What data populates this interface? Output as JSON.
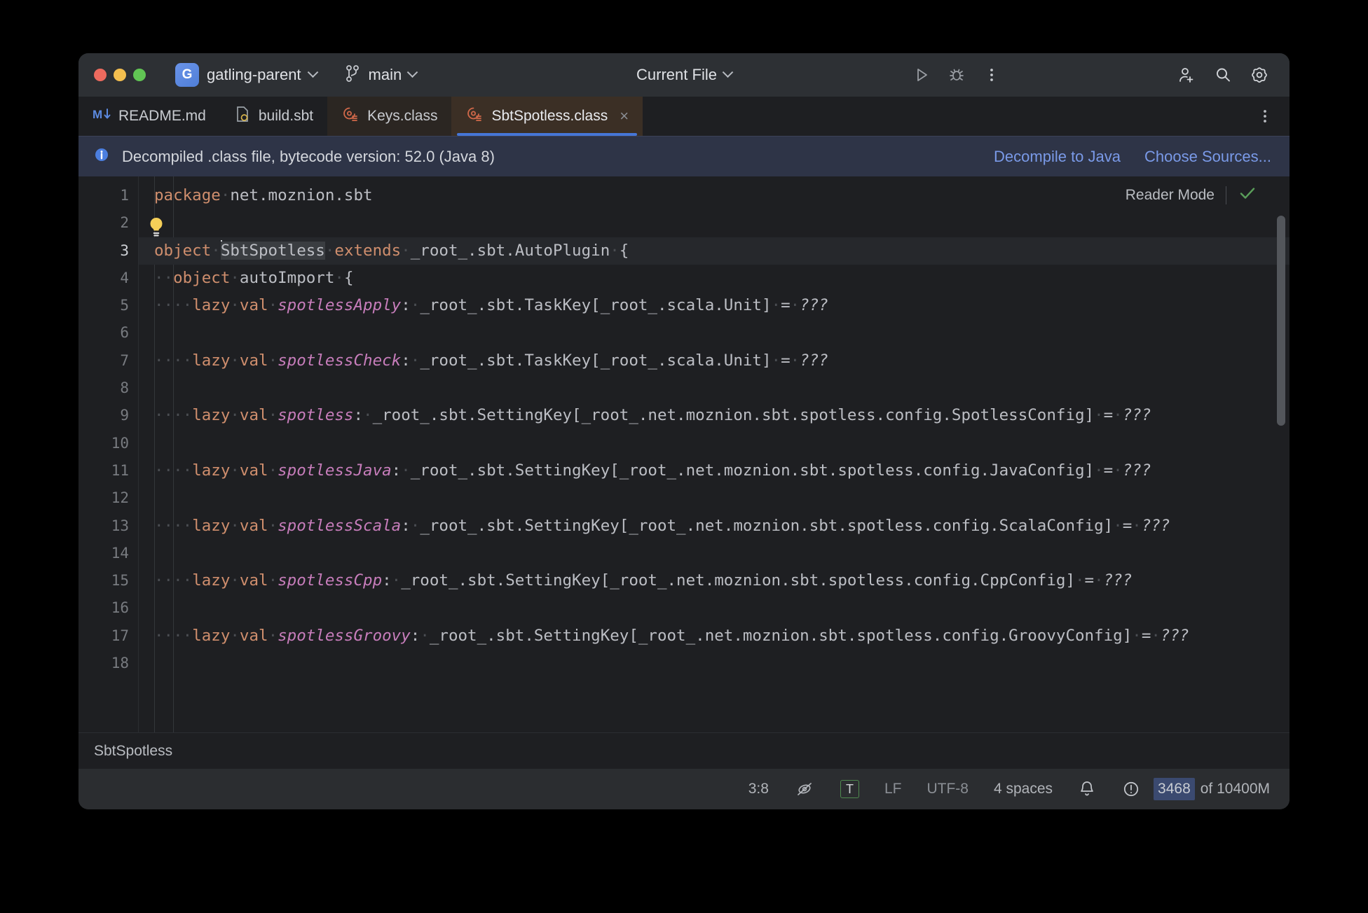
{
  "window": {
    "traffic_lights": [
      "close",
      "minimize",
      "zoom"
    ],
    "project": {
      "badge": "G",
      "name": "gatling-parent"
    },
    "branch": {
      "name": "main",
      "icon": "git-branch-icon"
    },
    "run_config": {
      "label": "Current File"
    },
    "toolbar_icons": [
      "run-icon",
      "debug-icon",
      "more-vertical-icon",
      "add-user-icon",
      "search-icon",
      "settings-gear-icon"
    ]
  },
  "tabs": {
    "items": [
      {
        "label": "README.md",
        "icon": "markdown-icon",
        "active": false,
        "closable": false
      },
      {
        "label": "build.sbt",
        "icon": "sbt-file-icon",
        "active": false,
        "closable": false
      },
      {
        "label": "Keys.class",
        "icon": "scala-class-icon",
        "active": false,
        "closable": false
      },
      {
        "label": "SbtSpotless.class",
        "icon": "scala-class-icon",
        "active": true,
        "closable": true,
        "close_glyph": "×"
      }
    ],
    "more_label": "more-tabs-icon"
  },
  "banner": {
    "icon": "info-icon",
    "message": "Decompiled .class file, bytecode version: 52.0 (Java 8)",
    "actions": [
      "Decompile to Java",
      "Choose Sources..."
    ]
  },
  "reader_mode": {
    "label": "Reader Mode",
    "check_icon": "check-icon",
    "check_color": "#5a9e5a"
  },
  "editor": {
    "cursor_line": 3,
    "line_numbers": [
      1,
      2,
      3,
      4,
      5,
      6,
      7,
      8,
      9,
      10,
      11,
      12,
      13,
      14,
      15,
      16,
      17,
      18
    ],
    "lines": [
      {
        "n": 1,
        "tokens": [
          {
            "t": "package",
            "c": "kw"
          },
          {
            "t": "·",
            "c": "dot"
          },
          {
            "t": "net.moznion.sbt",
            "c": "plain"
          }
        ]
      },
      {
        "n": 2,
        "tokens": []
      },
      {
        "n": 3,
        "highlighted": true,
        "tokens": [
          {
            "t": "object",
            "c": "kw"
          },
          {
            "t": "·",
            "c": "dot"
          },
          {
            "t": "SbtSpotless",
            "c": "occ"
          },
          {
            "t": "·",
            "c": "dot"
          },
          {
            "t": "extends",
            "c": "kw"
          },
          {
            "t": "·",
            "c": "dot"
          },
          {
            "t": "_root_.sbt.AutoPlugin",
            "c": "plain"
          },
          {
            "t": "·",
            "c": "dot"
          },
          {
            "t": "{",
            "c": "plain"
          }
        ]
      },
      {
        "n": 4,
        "tokens": [
          {
            "t": "··",
            "c": "dot"
          },
          {
            "t": "object",
            "c": "kw"
          },
          {
            "t": "·",
            "c": "dot"
          },
          {
            "t": "autoImport",
            "c": "plain"
          },
          {
            "t": "·",
            "c": "dot"
          },
          {
            "t": "{",
            "c": "plain"
          }
        ]
      },
      {
        "n": 5,
        "tokens": [
          {
            "t": "····",
            "c": "dot"
          },
          {
            "t": "lazy",
            "c": "kw"
          },
          {
            "t": "·",
            "c": "dot"
          },
          {
            "t": "val",
            "c": "kw"
          },
          {
            "t": "·",
            "c": "dot"
          },
          {
            "t": "spotlessApply",
            "c": "id"
          },
          {
            "t": ":",
            "c": "plain"
          },
          {
            "t": "·",
            "c": "dot"
          },
          {
            "t": "_root_.sbt.TaskKey[_root_.scala.Unit]",
            "c": "plain"
          },
          {
            "t": "·",
            "c": "dot"
          },
          {
            "t": "=",
            "c": "plain"
          },
          {
            "t": "·",
            "c": "dot"
          },
          {
            "t": "???",
            "c": "ital"
          }
        ]
      },
      {
        "n": 6,
        "tokens": []
      },
      {
        "n": 7,
        "tokens": [
          {
            "t": "····",
            "c": "dot"
          },
          {
            "t": "lazy",
            "c": "kw"
          },
          {
            "t": "·",
            "c": "dot"
          },
          {
            "t": "val",
            "c": "kw"
          },
          {
            "t": "·",
            "c": "dot"
          },
          {
            "t": "spotlessCheck",
            "c": "id"
          },
          {
            "t": ":",
            "c": "plain"
          },
          {
            "t": "·",
            "c": "dot"
          },
          {
            "t": "_root_.sbt.TaskKey[_root_.scala.Unit]",
            "c": "plain"
          },
          {
            "t": "·",
            "c": "dot"
          },
          {
            "t": "=",
            "c": "plain"
          },
          {
            "t": "·",
            "c": "dot"
          },
          {
            "t": "???",
            "c": "ital"
          }
        ]
      },
      {
        "n": 8,
        "tokens": []
      },
      {
        "n": 9,
        "tokens": [
          {
            "t": "····",
            "c": "dot"
          },
          {
            "t": "lazy",
            "c": "kw"
          },
          {
            "t": "·",
            "c": "dot"
          },
          {
            "t": "val",
            "c": "kw"
          },
          {
            "t": "·",
            "c": "dot"
          },
          {
            "t": "spotless",
            "c": "id"
          },
          {
            "t": ":",
            "c": "plain"
          },
          {
            "t": "·",
            "c": "dot"
          },
          {
            "t": "_root_.sbt.SettingKey[_root_.net.moznion.sbt.spotless.config.SpotlessConfig]",
            "c": "plain"
          },
          {
            "t": "·",
            "c": "dot"
          },
          {
            "t": "=",
            "c": "plain"
          },
          {
            "t": "·",
            "c": "dot"
          },
          {
            "t": "???",
            "c": "ital"
          }
        ]
      },
      {
        "n": 10,
        "tokens": []
      },
      {
        "n": 11,
        "tokens": [
          {
            "t": "····",
            "c": "dot"
          },
          {
            "t": "lazy",
            "c": "kw"
          },
          {
            "t": "·",
            "c": "dot"
          },
          {
            "t": "val",
            "c": "kw"
          },
          {
            "t": "·",
            "c": "dot"
          },
          {
            "t": "spotlessJava",
            "c": "id"
          },
          {
            "t": ":",
            "c": "plain"
          },
          {
            "t": "·",
            "c": "dot"
          },
          {
            "t": "_root_.sbt.SettingKey[_root_.net.moznion.sbt.spotless.config.JavaConfig]",
            "c": "plain"
          },
          {
            "t": "·",
            "c": "dot"
          },
          {
            "t": "=",
            "c": "plain"
          },
          {
            "t": "·",
            "c": "dot"
          },
          {
            "t": "???",
            "c": "ital"
          }
        ]
      },
      {
        "n": 12,
        "tokens": []
      },
      {
        "n": 13,
        "tokens": [
          {
            "t": "····",
            "c": "dot"
          },
          {
            "t": "lazy",
            "c": "kw"
          },
          {
            "t": "·",
            "c": "dot"
          },
          {
            "t": "val",
            "c": "kw"
          },
          {
            "t": "·",
            "c": "dot"
          },
          {
            "t": "spotlessScala",
            "c": "id"
          },
          {
            "t": ":",
            "c": "plain"
          },
          {
            "t": "·",
            "c": "dot"
          },
          {
            "t": "_root_.sbt.SettingKey[_root_.net.moznion.sbt.spotless.config.ScalaConfig]",
            "c": "plain"
          },
          {
            "t": "·",
            "c": "dot"
          },
          {
            "t": "=",
            "c": "plain"
          },
          {
            "t": "·",
            "c": "dot"
          },
          {
            "t": "???",
            "c": "ital"
          }
        ]
      },
      {
        "n": 14,
        "tokens": []
      },
      {
        "n": 15,
        "tokens": [
          {
            "t": "····",
            "c": "dot"
          },
          {
            "t": "lazy",
            "c": "kw"
          },
          {
            "t": "·",
            "c": "dot"
          },
          {
            "t": "val",
            "c": "kw"
          },
          {
            "t": "·",
            "c": "dot"
          },
          {
            "t": "spotlessCpp",
            "c": "id"
          },
          {
            "t": ":",
            "c": "plain"
          },
          {
            "t": "·",
            "c": "dot"
          },
          {
            "t": "_root_.sbt.SettingKey[_root_.net.moznion.sbt.spotless.config.CppConfig]",
            "c": "plain"
          },
          {
            "t": "·",
            "c": "dot"
          },
          {
            "t": "=",
            "c": "plain"
          },
          {
            "t": "·",
            "c": "dot"
          },
          {
            "t": "???",
            "c": "ital"
          }
        ]
      },
      {
        "n": 16,
        "tokens": []
      },
      {
        "n": 17,
        "tokens": [
          {
            "t": "····",
            "c": "dot"
          },
          {
            "t": "lazy",
            "c": "kw"
          },
          {
            "t": "·",
            "c": "dot"
          },
          {
            "t": "val",
            "c": "kw"
          },
          {
            "t": "·",
            "c": "dot"
          },
          {
            "t": "spotlessGroovy",
            "c": "id"
          },
          {
            "t": ":",
            "c": "plain"
          },
          {
            "t": "·",
            "c": "dot"
          },
          {
            "t": "_root_.sbt.SettingKey[_root_.net.moznion.sbt.spotless.config.GroovyConfig]",
            "c": "plain"
          },
          {
            "t": "·",
            "c": "dot"
          },
          {
            "t": "=",
            "c": "plain"
          },
          {
            "t": "·",
            "c": "dot"
          },
          {
            "t": "???",
            "c": "ital"
          }
        ]
      },
      {
        "n": 18,
        "tokens": []
      }
    ],
    "intention_bulb": "lightbulb-icon"
  },
  "breadcrumb": {
    "path": "SbtSpotless"
  },
  "statusbar": {
    "caret_position": "3:8",
    "inspection_icon": "inspections-off-icon",
    "transpose_badge": "T",
    "line_separator": "LF",
    "encoding": "UTF-8",
    "indent": "4 spaces",
    "notifications_icon": "bell-icon",
    "problems_icon": "warning-circle-icon",
    "memory_used": "3468",
    "memory_total": " of 10400M"
  },
  "colors": {
    "window_bg": "#1e1f22",
    "titlebar_bg": "#2d3034",
    "tab_active_bg": "#3b2f25",
    "tab_inactive_bg": "#2b2622",
    "tab_underline": "#4676d7",
    "banner_bg": "#2e3447",
    "link": "#7a9ae8",
    "keyword": "#cf8e6d",
    "identifier": "#c77dbb",
    "text": "#bcbec4",
    "status_bg": "#2b2d30",
    "memory_fill": "#3b4a70"
  }
}
